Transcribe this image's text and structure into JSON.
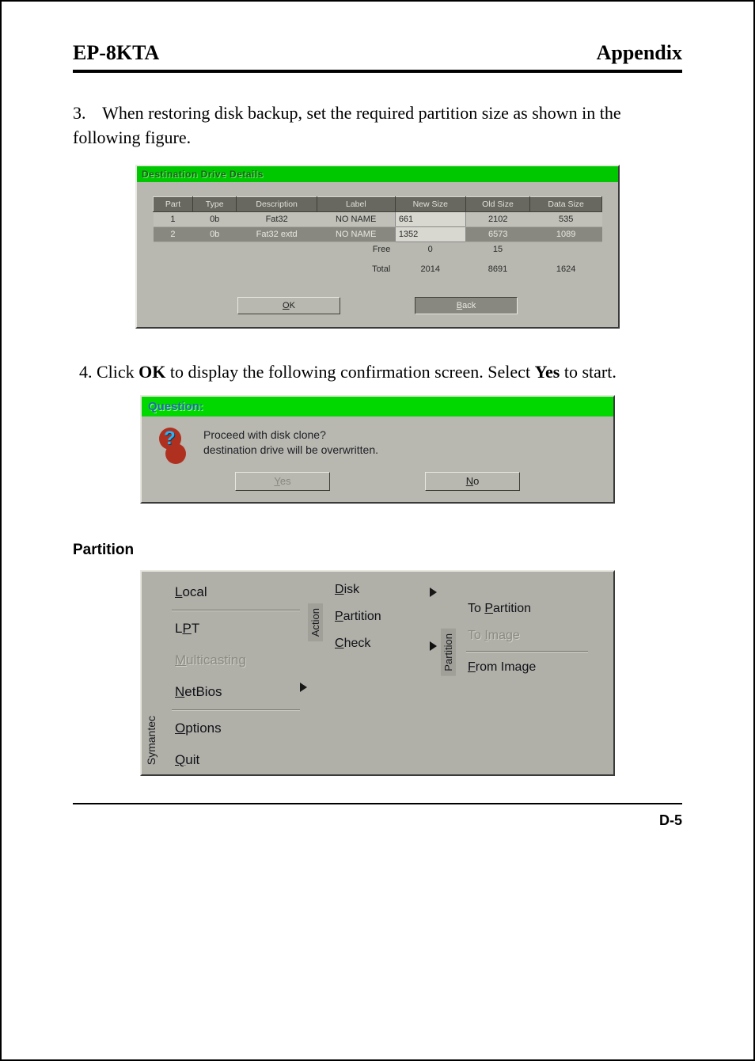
{
  "header": {
    "left": "EP-8KTA",
    "right": "Appendix"
  },
  "step3": {
    "num": "3.",
    "text": "When restoring disk backup, set the required partition size as shown in the following figure."
  },
  "ddd": {
    "title": "Destination Drive Details",
    "headers": [
      "Part",
      "Type",
      "Description",
      "Label",
      "New Size",
      "Old Size",
      "Data Size"
    ],
    "rows": [
      {
        "part": "1",
        "type": "0b",
        "desc": "Fat32",
        "label": "NO NAME",
        "new": "661",
        "old": "2102",
        "data": "535"
      },
      {
        "part": "2",
        "type": "0b",
        "desc": "Fat32 extd",
        "label": "NO NAME",
        "new": "1352",
        "old": "6573",
        "data": "1089"
      }
    ],
    "free": {
      "label": "Free",
      "new": "0",
      "old": "15",
      "data": ""
    },
    "total": {
      "label": "Total",
      "new": "2014",
      "old": "8691",
      "data": "1624"
    },
    "ok": "OK",
    "back": "Back"
  },
  "step4": {
    "num": "4.",
    "t1": "Click ",
    "b1": "OK",
    "t2": " to display the following confirmation screen.  Select ",
    "b2": "Yes",
    "t3": " to start."
  },
  "question": {
    "title": "Question:",
    "line1": "Proceed with disk clone?",
    "line2": "destination drive will be overwritten.",
    "yes": "Yes",
    "no": "No"
  },
  "partition_heading": "Partition",
  "menu": {
    "symantec": "Symantec",
    "action": "Action",
    "partition_tab": "Partition",
    "col1": [
      "Local",
      "LPT",
      "Multicasting",
      "NetBios",
      "Options",
      "Quit"
    ],
    "col2": [
      "Disk",
      "Partition",
      "Check"
    ],
    "col3": [
      "To Partition",
      "To Image",
      "From Image"
    ]
  },
  "pagenum": "D-5"
}
